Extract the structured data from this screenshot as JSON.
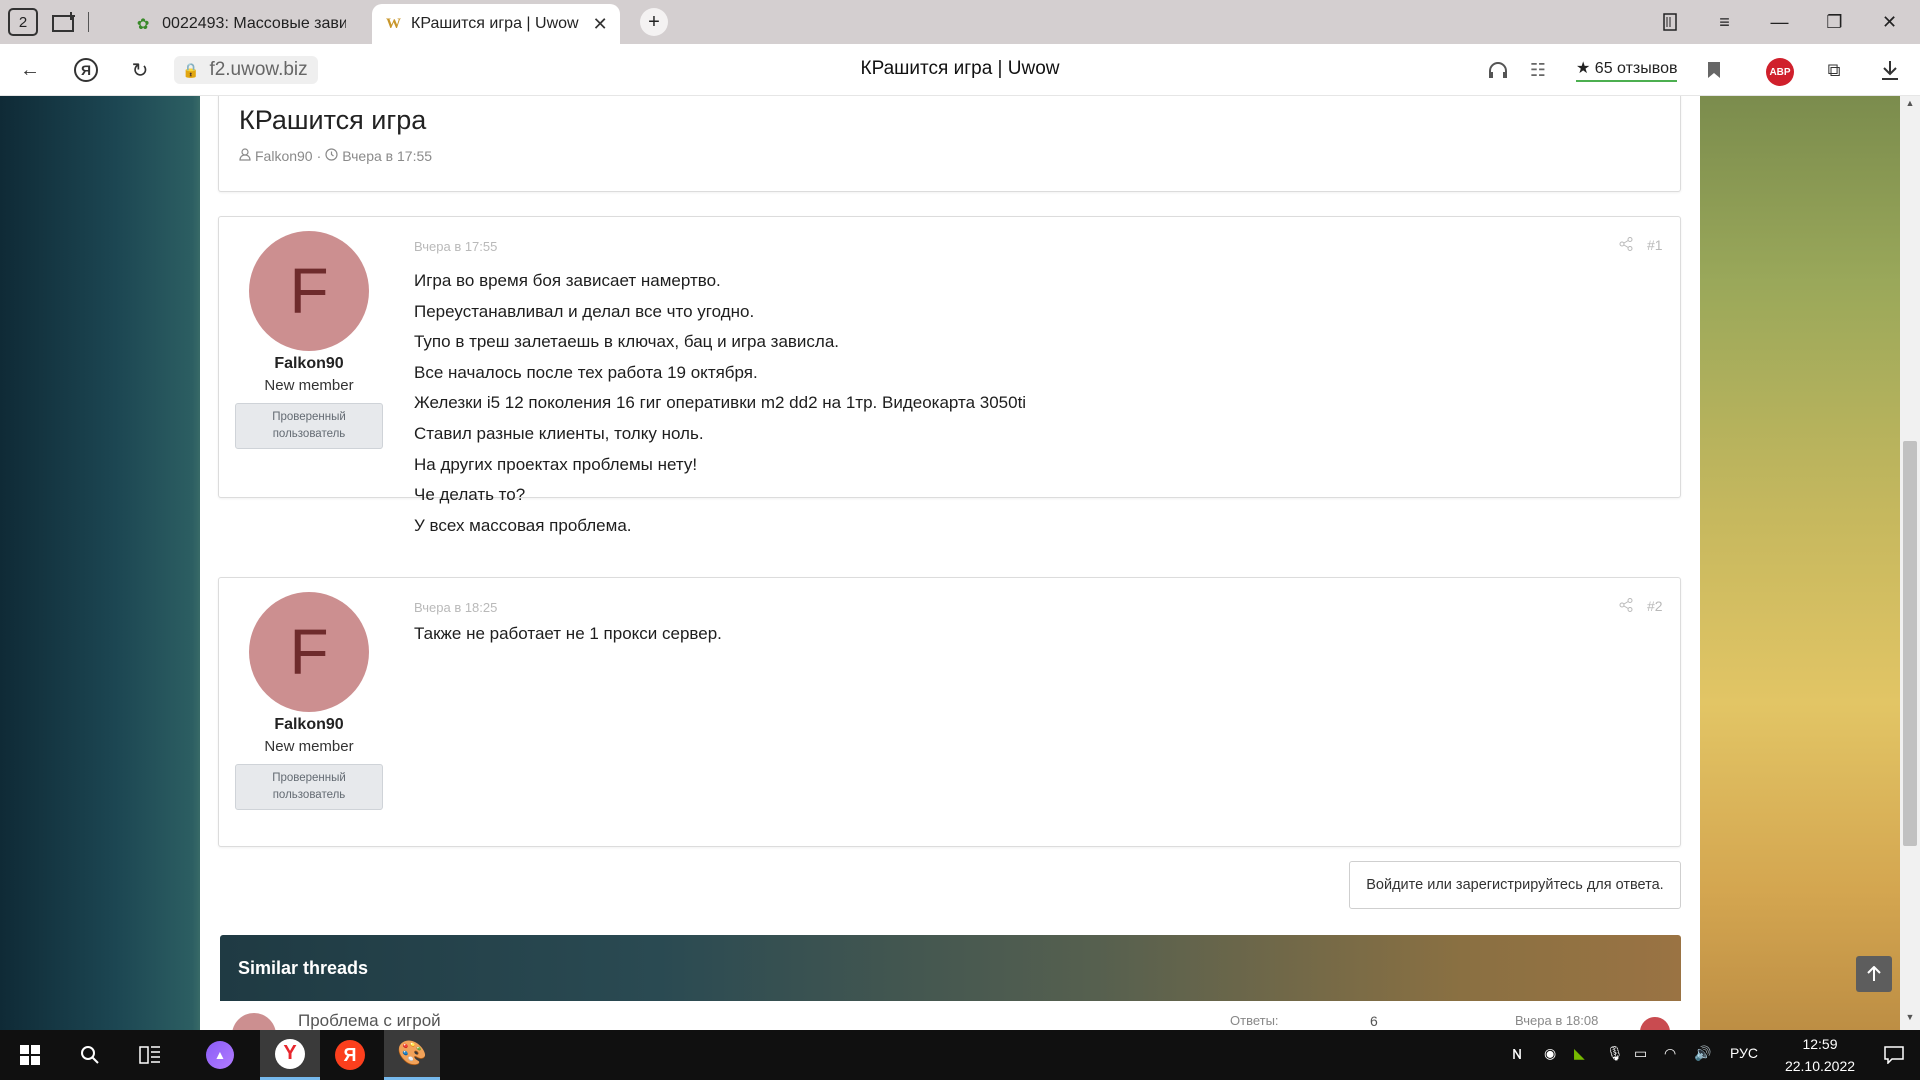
{
  "browser": {
    "home_badge": "2",
    "tabs": [
      {
        "title": "0022493: Массовые зависа"
      },
      {
        "title": "КРашится игра | Uwow"
      }
    ],
    "new_tab_symbol": "+",
    "url": "f2.uwow.biz",
    "page_title": "КРашится игра | Uwow",
    "reviews": "★ 65 отзывов",
    "abp_label": "ABP"
  },
  "thread": {
    "title": "КРашится игра",
    "author": "Falkon90",
    "date": "Вчера в 17:55"
  },
  "posts": [
    {
      "avatar_letter": "F",
      "username": "Falkon90",
      "user_title": "New member",
      "badge_line1": "Проверенный",
      "badge_line2": "пользователь",
      "date": "Вчера в 17:55",
      "number": "#1",
      "lines": [
        "Игра во время боя зависает намертво.",
        "Переустанавливал и делал все что угодно.",
        "Тупо в треш залетаешь в ключах, бац и игра зависла.",
        "Все началось после тех работа 19 октября.",
        "Железки i5 12 поколения 16 гиг оперативки m2 dd2 на 1тр. Видеокарта 3050ti",
        "Ставил разные клиенты, толку ноль.",
        "На других проектах проблемы нету!",
        "Че делать то?",
        "У всех массовая проблема."
      ]
    },
    {
      "avatar_letter": "F",
      "username": "Falkon90",
      "user_title": "New member",
      "badge_line1": "Проверенный",
      "badge_line2": "пользователь",
      "date": "Вчера в 18:25",
      "number": "#2",
      "lines": [
        "Также не работает не 1 прокси сервер."
      ]
    }
  ],
  "reply_prompt": "Войдите или зарегистрируйтесь для ответа.",
  "similar": {
    "heading": "Similar threads",
    "item_title": "Проблема с игрой",
    "replies_label": "Ответы:",
    "replies_value": "6",
    "item_date": "Вчера в 18:08"
  },
  "taskbar": {
    "language": "РУС",
    "time": "12:59",
    "date": "22.10.2022"
  },
  "colors": {
    "avatar": "#cc8f90",
    "avatar_letter": "#6e2b2c",
    "abp": "#d0202c"
  }
}
